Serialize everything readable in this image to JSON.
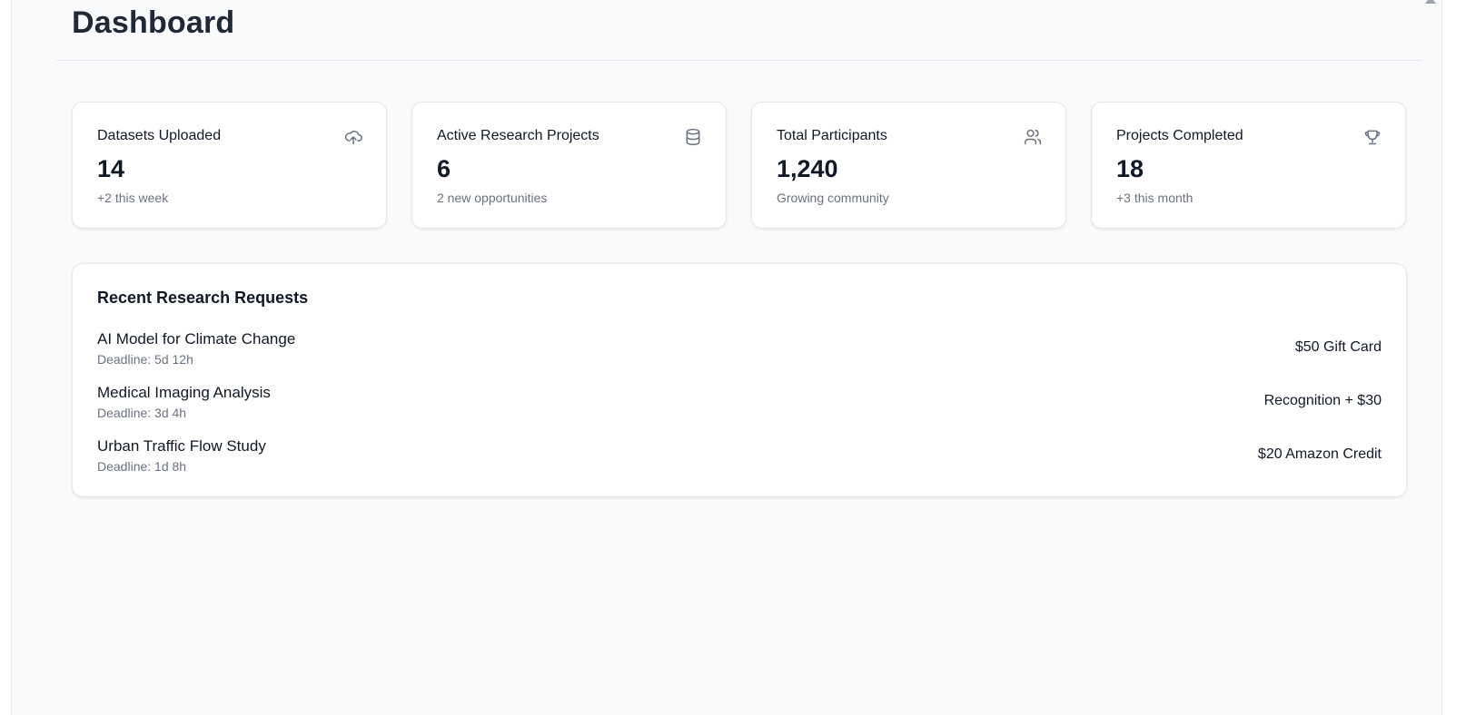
{
  "header": {
    "title": "Dashboard"
  },
  "stats": [
    {
      "title": "Datasets Uploaded",
      "value": "14",
      "sub": "+2 this week",
      "icon": "upload-cloud-icon"
    },
    {
      "title": "Active Research Projects",
      "value": "6",
      "sub": "2 new opportunities",
      "icon": "database-icon"
    },
    {
      "title": "Total Participants",
      "value": "1,240",
      "sub": "Growing community",
      "icon": "users-icon"
    },
    {
      "title": "Projects Completed",
      "value": "18",
      "sub": "+3 this month",
      "icon": "trophy-icon"
    }
  ],
  "requests": {
    "title": "Recent Research Requests",
    "items": [
      {
        "name": "AI Model for Climate Change",
        "deadline": "Deadline: 5d 12h",
        "reward": "$50 Gift Card"
      },
      {
        "name": "Medical Imaging Analysis",
        "deadline": "Deadline: 3d 4h",
        "reward": "Recognition + $30"
      },
      {
        "name": "Urban Traffic Flow Study",
        "deadline": "Deadline: 1d 8h",
        "reward": "$20 Amazon Credit"
      }
    ]
  },
  "colors": {
    "background": "#f8fafc",
    "card": "#ffffff",
    "text_primary": "#111827",
    "text_muted": "#6b7280"
  }
}
